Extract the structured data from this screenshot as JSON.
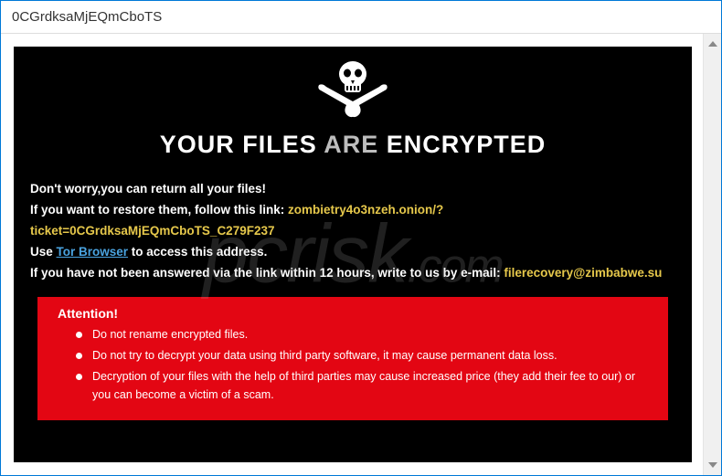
{
  "window": {
    "title": "0CGrdksaMjEQmCboTS"
  },
  "heading": {
    "p1": "YOUR FILES ",
    "are": "ARE",
    "p2": " ENCRYPTED"
  },
  "lines": {
    "l1": "Don't worry,you can return all your files!",
    "l2a": "If you want to restore them, follow this link: ",
    "l2link": "zombietry4o3nzeh.onion/?ticket=0CGrdksaMjEQmCboTS_C279F237",
    "l3a": "Use ",
    "l3link": "Tor Browser",
    "l3b": " to access this address.",
    "l4a": "If you have not been answered via the link within 12 hours, write to us by e-mail: ",
    "l4link": "filerecovery@zimbabwe.su"
  },
  "attention": {
    "title": "Attention!",
    "items": [
      "Do not rename encrypted files.",
      "Do not try to decrypt your data using third party software, it may cause permanent data loss.",
      "Decryption of your files with the help of third parties may cause increased price (they add their fee to our) or you can become a victim of a scam."
    ]
  },
  "watermark": {
    "big": "pcrisk",
    "small": ".com"
  }
}
